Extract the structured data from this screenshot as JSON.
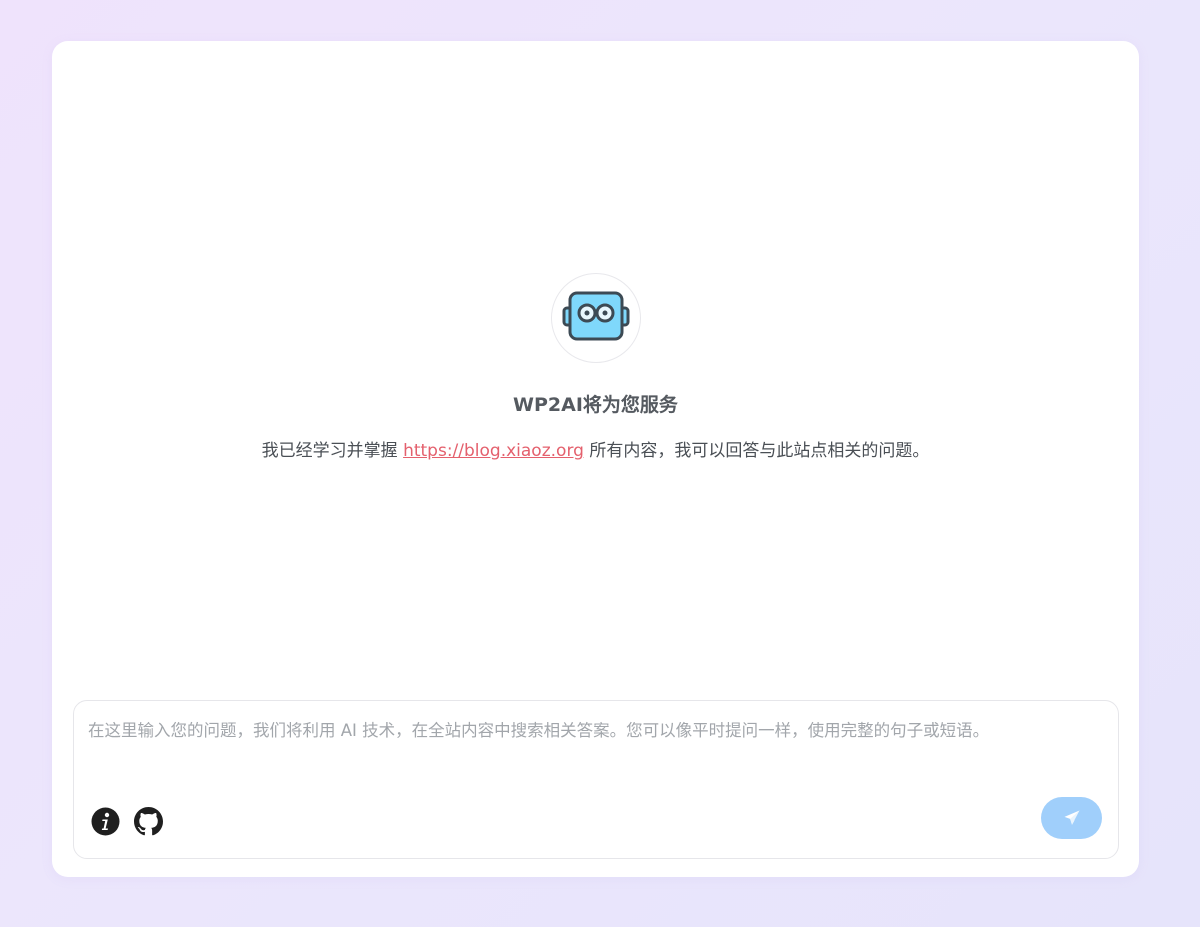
{
  "welcome": {
    "avatar_icon": "robot-icon",
    "title": "WP2AI将为您服务",
    "desc_prefix": "我已经学习并掌握 ",
    "site_link": "https://blog.xiaoz.org",
    "desc_suffix": " 所有内容，我可以回答与此站点相关的问题。"
  },
  "input": {
    "value": "",
    "placeholder": "在这里输入您的问题，我们将利用 AI 技术，在全站内容中搜索相关答案。您可以像平时提问一样，使用完整的句子或短语。"
  },
  "toolbar": {
    "info_icon": "info-icon",
    "github_icon": "github-icon",
    "send_icon": "paper-plane-icon"
  },
  "colors": {
    "link": "#e4606d",
    "send_button": "#a0cffb",
    "robot_face": "#7fd8fb",
    "robot_outline": "#3c4a54"
  }
}
